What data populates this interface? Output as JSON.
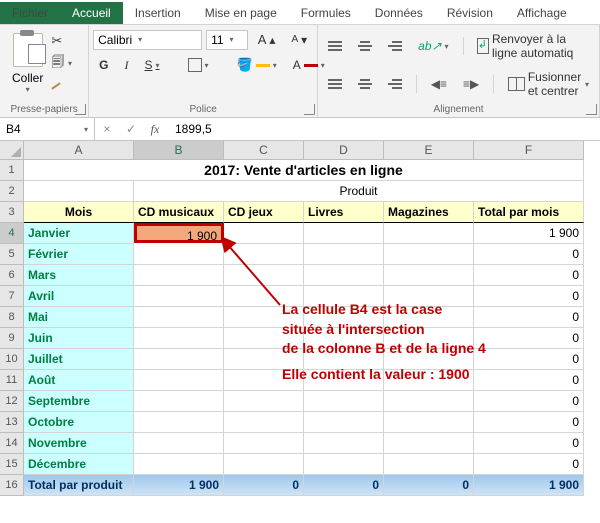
{
  "tabs": {
    "fichier": "Fichier",
    "accueil": "Accueil",
    "insertion": "Insertion",
    "mise_en_page": "Mise en page",
    "formules": "Formules",
    "donnees": "Données",
    "revision": "Révision",
    "affichage": "Affichage"
  },
  "clipboard": {
    "paste": "Coller",
    "label": "Presse-papiers"
  },
  "font": {
    "name": "Calibri",
    "size": "11",
    "b": "G",
    "i": "I",
    "u": "S",
    "A": "A",
    "label": "Police",
    "grow": "A",
    "shrink": "A"
  },
  "align": {
    "wrap": "Renvoyer à la ligne automatiq",
    "merge": "Fusionner et centrer",
    "label": "Alignement"
  },
  "namebox": "B4",
  "fx": "fx",
  "fx_cancel": "×",
  "fx_ok": "✓",
  "formula": "1899,5",
  "sheet": {
    "cols": [
      "A",
      "B",
      "C",
      "D",
      "E",
      "F"
    ],
    "title": "2017: Vente d'articles en ligne",
    "subtitle": "Produit",
    "headers": [
      "Mois",
      "CD musicaux",
      "CD jeux",
      "Livres",
      "Magazines",
      "Total par mois"
    ],
    "rows": [
      {
        "n": "4",
        "m": "Janvier",
        "b": "1 900",
        "f": "1 900"
      },
      {
        "n": "5",
        "m": "Février",
        "f": "0"
      },
      {
        "n": "6",
        "m": "Mars",
        "f": "0"
      },
      {
        "n": "7",
        "m": "Avril",
        "f": "0"
      },
      {
        "n": "8",
        "m": "Mai",
        "f": "0"
      },
      {
        "n": "9",
        "m": "Juin",
        "f": "0"
      },
      {
        "n": "10",
        "m": "Juillet",
        "f": "0"
      },
      {
        "n": "11",
        "m": "Août",
        "f": "0"
      },
      {
        "n": "12",
        "m": "Septembre",
        "f": "0"
      },
      {
        "n": "13",
        "m": "Octobre",
        "f": "0"
      },
      {
        "n": "14",
        "m": "Novembre",
        "f": "0"
      },
      {
        "n": "15",
        "m": "Décembre",
        "f": "0"
      }
    ],
    "total_label": "Total par produit",
    "totals": {
      "n": "16",
      "b": "1 900",
      "c": "0",
      "d": "0",
      "e": "0",
      "f": "1 900"
    }
  },
  "annotation": {
    "l1": "La cellule B4 est la case",
    "l2": "située à l'intersection",
    "l3": "de la colonne B et de la ligne 4",
    "l4": "Elle contient la valeur : 1900"
  }
}
